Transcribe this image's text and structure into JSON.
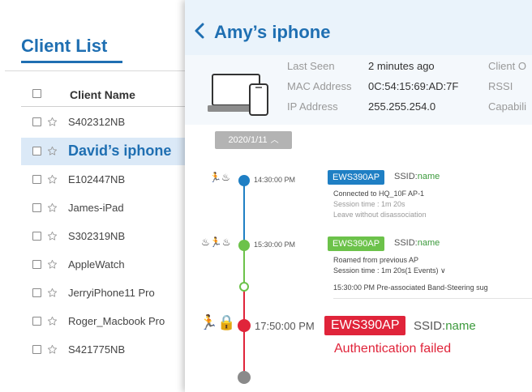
{
  "client_list": {
    "title": "Client List",
    "column_header": "Client Name",
    "rows": [
      {
        "name": "S402312NB",
        "selected": false
      },
      {
        "name": "David’s iphone",
        "selected": true
      },
      {
        "name": "E102447NB",
        "selected": false
      },
      {
        "name": "James-iPad",
        "selected": false
      },
      {
        "name": "S302319NB",
        "selected": false
      },
      {
        "name": "AppleWatch",
        "selected": false
      },
      {
        "name": "JerryiPhone11 Pro",
        "selected": false
      },
      {
        "name": "Roger_Macbook Pro",
        "selected": false
      },
      {
        "name": "S421775NB",
        "selected": false
      }
    ]
  },
  "detail": {
    "title": "Amy’s iphone",
    "info": {
      "last_seen_label": "Last Seen",
      "last_seen_value": "2 minutes ago",
      "mac_label": "MAC Address",
      "mac_value": "0C:54:15:69:AD:7F",
      "ip_label": "IP Address",
      "ip_value": "255.255.254.0",
      "client_os_label": "Client O",
      "rssi_label": "RSSI",
      "capability_label": "Capabili"
    },
    "date": "2020/1/11",
    "events": [
      {
        "time": "14:30:00 PM",
        "icons": "🏃♨",
        "ap": "EWS390AP",
        "ssid_label": "SSID:",
        "ssid_value": "name",
        "line1": "Connected to HQ_10F AP-1",
        "line2": "Session time : 1m 20s",
        "line3": "Leave without disassociation",
        "color": "#1f7fc4"
      },
      {
        "time": "15:30:00 PM",
        "icons": "♨🏃♨",
        "ap": "EWS390AP",
        "ssid_label": "SSID:",
        "ssid_value": "name",
        "line1": "Roamed from previous AP",
        "line2": "Session time : 1m 20s(1 Events) ∨",
        "color": "#6cc24a"
      },
      {
        "sub_text": "15:30:00 PM  Pre-associated Band-Steering sug"
      },
      {
        "time": "17:50:00 PM",
        "icons": "🏃🔒",
        "ap": "EWS390AP",
        "ssid_label": "SSID:",
        "ssid_value": "name",
        "line1": "Authentication failed",
        "color": "#e0243a"
      }
    ]
  },
  "icons": {
    "star": "star-icon",
    "back": "chevron-left-icon",
    "device": "laptop-phone-icon",
    "running": "running-person-icon",
    "lock": "lock-icon",
    "wifi": "signal-icon"
  },
  "colors": {
    "accent": "#1f6fb2",
    "blue_event": "#1f7fc4",
    "green_event": "#6cc24a",
    "red_event": "#e0243a",
    "end_dot": "#8a8a8a"
  }
}
